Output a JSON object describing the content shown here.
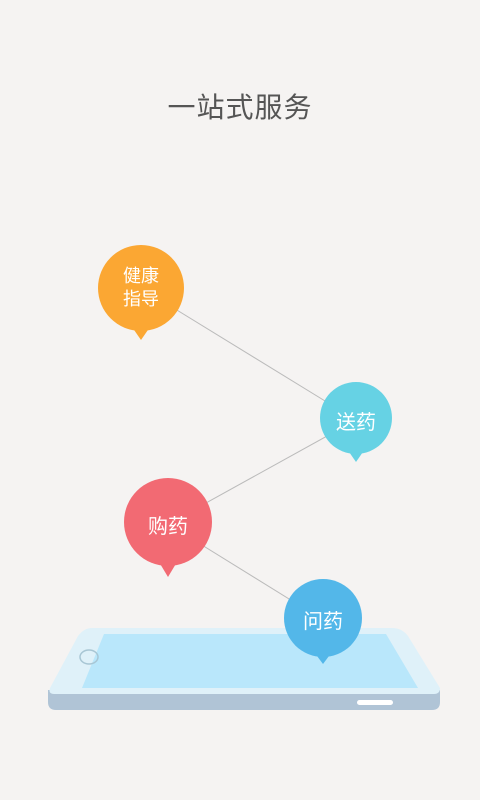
{
  "header": {
    "title": "一站式服务"
  },
  "bubbles": [
    {
      "id": "health",
      "line1": "健康",
      "line2": "指导",
      "color": "#fba733"
    },
    {
      "id": "delivery",
      "line1": "送药",
      "color": "#66d2e4"
    },
    {
      "id": "buy",
      "line1": "购药",
      "color": "#f26a73"
    },
    {
      "id": "ask",
      "line1": "问药",
      "color": "#53b7e9"
    }
  ],
  "colors": {
    "background": "#f5f3f2",
    "phone_body": "#dff1f9",
    "phone_screen": "#b9e7fb",
    "phone_base": "#b0c4d6",
    "connector": "#bbbbbb"
  }
}
